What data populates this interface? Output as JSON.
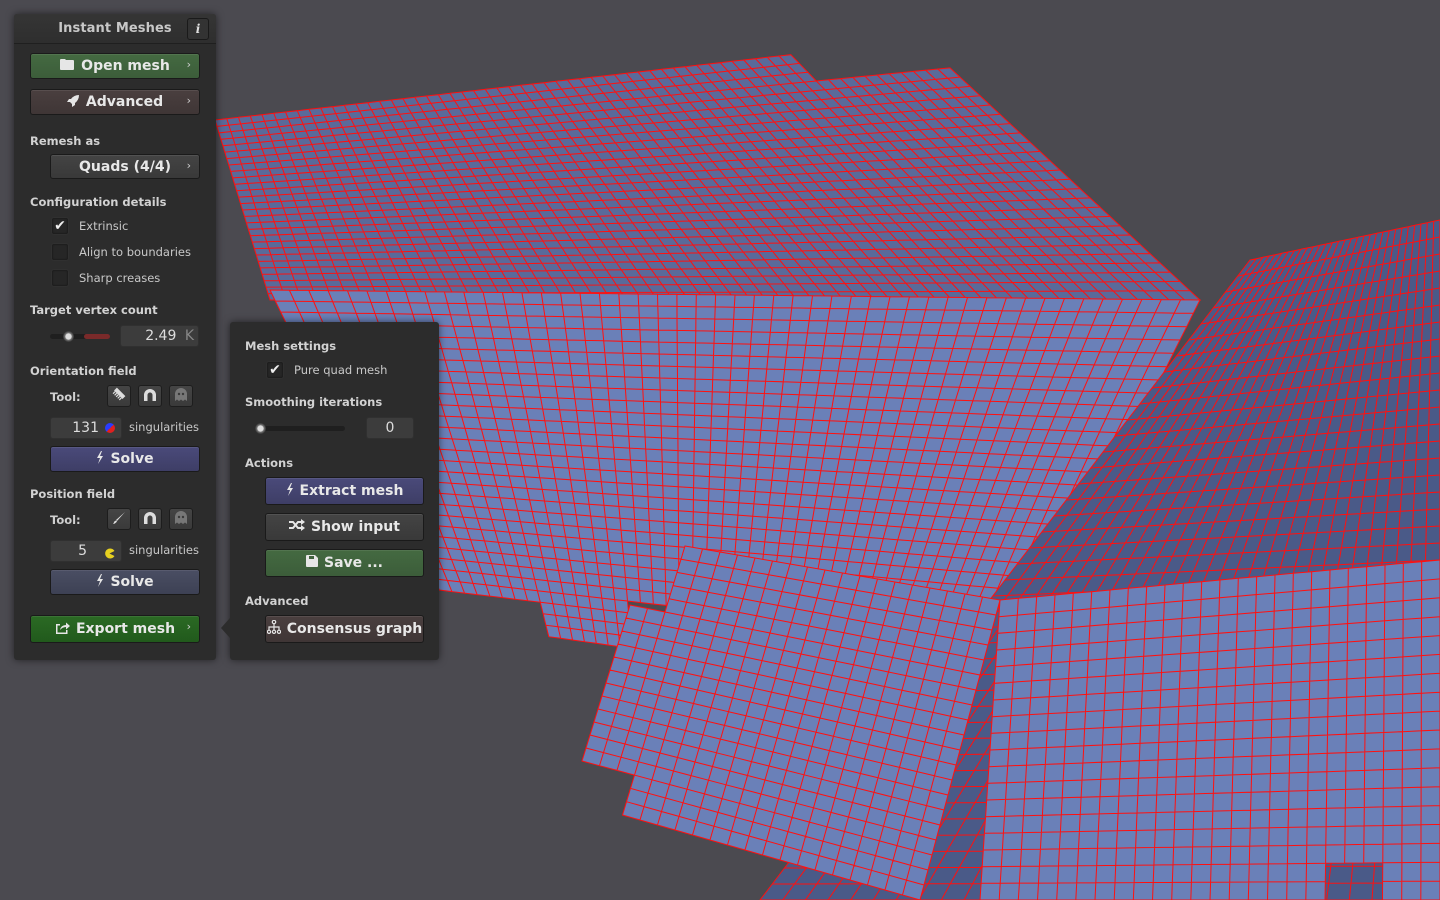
{
  "app": {
    "title": "Instant Meshes",
    "info_label": "i"
  },
  "main": {
    "open_mesh": "Open mesh",
    "advanced": "Advanced",
    "remesh_as_label": "Remesh as",
    "remesh_as_value": "Quads (4/4)",
    "configuration_label": "Configuration details",
    "checkboxes": [
      {
        "label": "Extrinsic",
        "checked": true
      },
      {
        "label": "Align to boundaries",
        "checked": false
      },
      {
        "label": "Sharp creases",
        "checked": false
      }
    ],
    "target_vertex_label": "Target vertex count",
    "target_vertex_value": "2.49",
    "target_vertex_unit": "K",
    "target_vertex_slider_fraction": 0.3,
    "orientation": {
      "label": "Orientation field",
      "tool_label": "Tool:",
      "tools": [
        "comb-icon",
        "magnet-icon",
        "ghost-icon"
      ],
      "singularities_count": "131",
      "singularities_label": "singularities",
      "solve": "Solve"
    },
    "position": {
      "label": "Position field",
      "tool_label": "Tool:",
      "tools": [
        "brush-icon",
        "magnet-icon",
        "ghost-icon"
      ],
      "singularities_count": "5",
      "singularities_label": "singularities",
      "solve": "Solve"
    },
    "export_mesh": "Export mesh"
  },
  "popup": {
    "mesh_settings_label": "Mesh settings",
    "pure_quad": {
      "label": "Pure quad mesh",
      "checked": true
    },
    "smoothing_label": "Smoothing iterations",
    "smoothing_value": "0",
    "smoothing_slider_fraction": 0.0,
    "actions_label": "Actions",
    "extract_mesh": "Extract mesh",
    "show_input": "Show input",
    "save": "Save ...",
    "advanced_label": "Advanced",
    "consensus_graph": "Consensus graph"
  },
  "colors": {
    "background": "#4b4a50",
    "mesh_face": "#6a80b8",
    "mesh_edge": "#ff1010",
    "panel": "#2c2c2c"
  }
}
